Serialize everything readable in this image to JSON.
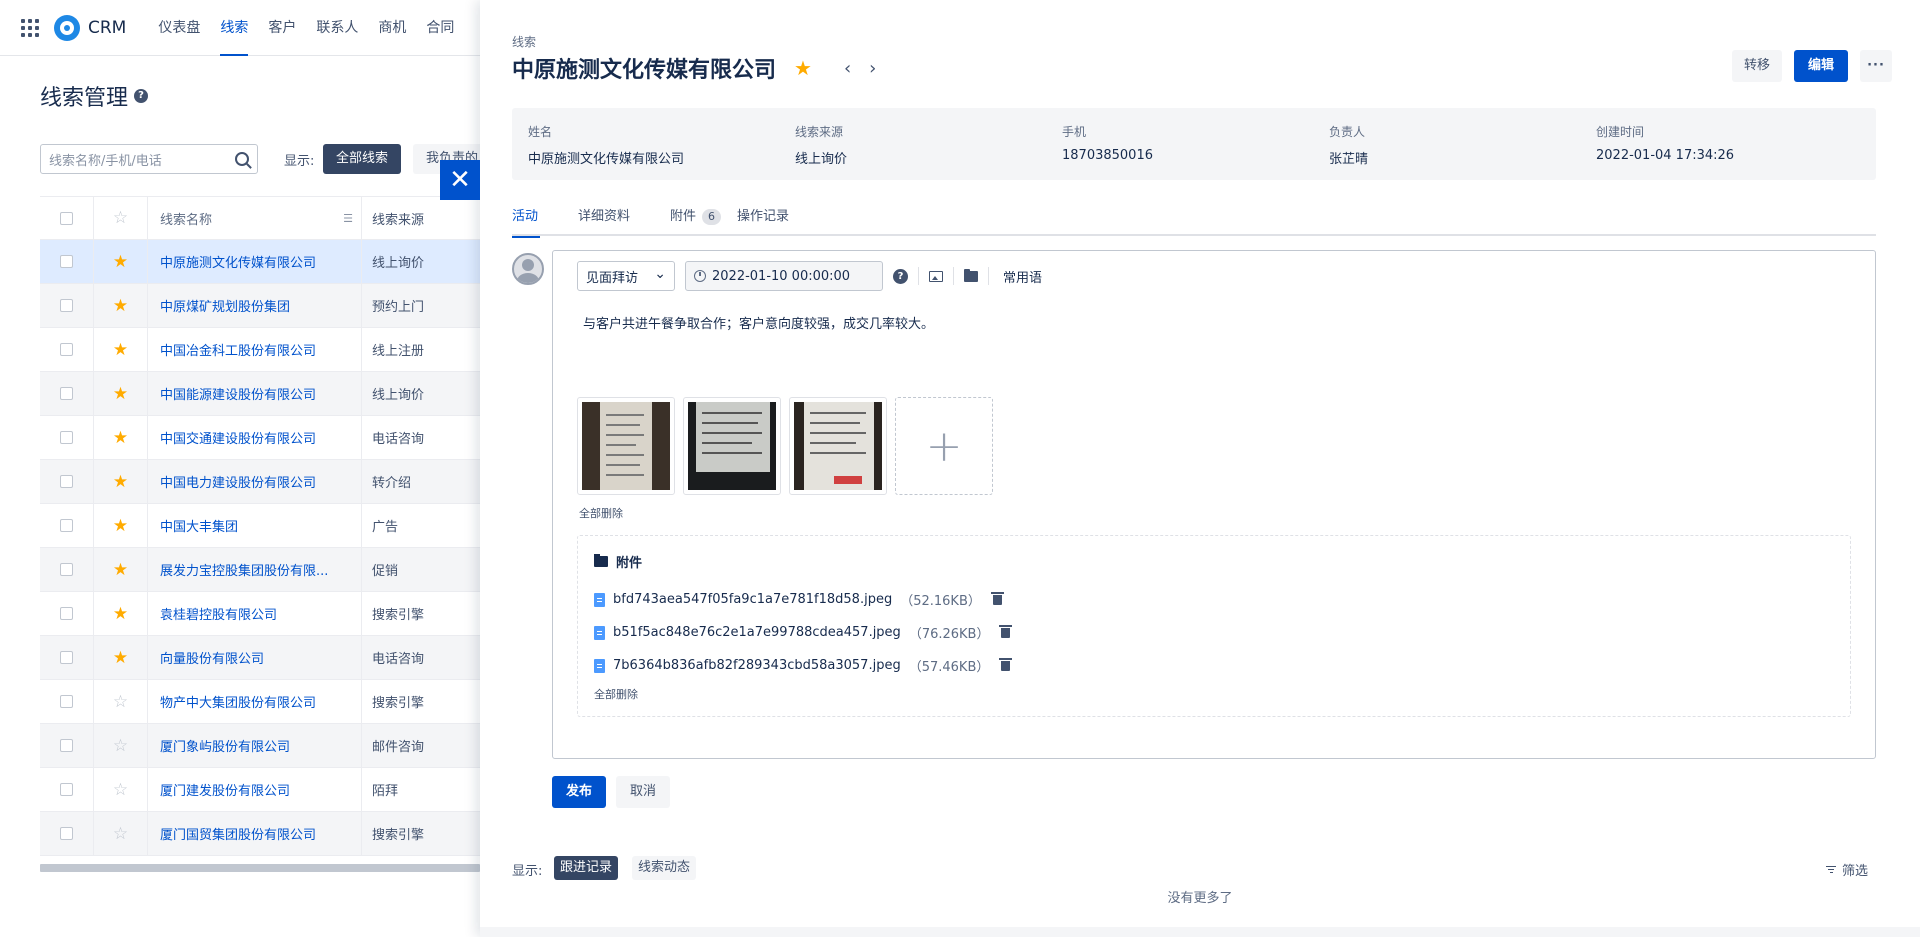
{
  "nav": {
    "brand": "CRM",
    "items": [
      "仪表盘",
      "线索",
      "客户",
      "联系人",
      "商机",
      "合同"
    ],
    "active_index": 1
  },
  "list_page": {
    "title": "线索管理",
    "help_icon": "?",
    "search_placeholder": "线索名称/手机/电话",
    "filter_label": "显示:",
    "filter_active": "全部线索",
    "filter_other": "我负责的",
    "columns": [
      "线索名称",
      "线索来源"
    ],
    "rows": [
      {
        "name": "中原施测文化传媒有限公司",
        "source": "线上询价",
        "starred": true,
        "selected": true
      },
      {
        "name": "中原煤矿规划股份集团",
        "source": "预约上门",
        "starred": true
      },
      {
        "name": "中国冶金科工股份有限公司",
        "source": "线上注册",
        "starred": true
      },
      {
        "name": "中国能源建设股份有限公司",
        "source": "线上询价",
        "starred": true
      },
      {
        "name": "中国交通建设股份有限公司",
        "source": "电话咨询",
        "starred": true
      },
      {
        "name": "中国电力建设股份有限公司",
        "source": "转介绍",
        "starred": true
      },
      {
        "name": "中国大丰集团",
        "source": "广告",
        "starred": true
      },
      {
        "name": "展发力宝控股集团股份有限...",
        "source": "促销",
        "starred": true
      },
      {
        "name": "袁桂碧控股有限公司",
        "source": "搜索引擎",
        "starred": true
      },
      {
        "name": "向量股份有限公司",
        "source": "电话咨询",
        "starred": true
      },
      {
        "name": "物产中大集团股份有限公司",
        "source": "搜索引擎",
        "starred": false
      },
      {
        "name": "厦门象屿股份有限公司",
        "source": "邮件咨询",
        "starred": false
      },
      {
        "name": "厦门建发股份有限公司",
        "source": "陌拜",
        "starred": false
      },
      {
        "name": "厦门国贸集团股份有限公司",
        "source": "搜索引擎",
        "starred": false
      }
    ],
    "close_glyph": "✕"
  },
  "detail": {
    "breadcrumb": "线索",
    "title": "中原施测文化传媒有限公司",
    "prev_glyph": "‹",
    "next_glyph": "›",
    "star_glyph": "★",
    "actions": {
      "transfer": "转移",
      "edit": "编辑",
      "more": "···"
    },
    "info": [
      {
        "label": "姓名",
        "value": "中原施测文化传媒有限公司"
      },
      {
        "label": "线索来源",
        "value": "线上询价"
      },
      {
        "label": "手机",
        "value": "18703850016"
      },
      {
        "label": "负责人",
        "value": "张芷晴"
      },
      {
        "label": "创建时间",
        "value": "2022-01-04 17:34:26"
      }
    ],
    "tabs": [
      {
        "label": "活动",
        "active": true
      },
      {
        "label": "详细资料"
      },
      {
        "label": "附件",
        "badge": "6"
      },
      {
        "label": "操作记录"
      }
    ],
    "editor": {
      "activity_type": "见面拜访",
      "chevron": "⌄",
      "datetime": "2022-01-10 00:00:00",
      "help": "?",
      "phrases": "常用语",
      "content": "与客户共进午餐争取合作；客户意向度较强，成交几率较大。",
      "add_glyph": "+",
      "delete_all_images": "全部删除",
      "attachments_title": "附件",
      "files": [
        {
          "name": "bfd743aea547f05fa9c1a7e781f18d58.jpeg",
          "size": "（52.16KB）"
        },
        {
          "name": "b51f5ac848e76c2e1a7e99788cdea457.jpeg",
          "size": "（76.26KB）"
        },
        {
          "name": "7b6364b836afb82f289343cbd58a3057.jpeg",
          "size": "（57.46KB）"
        }
      ],
      "delete_all_files": "全部删除",
      "publish": "发布",
      "cancel": "取消"
    },
    "feed": {
      "show_label": "显示:",
      "active": "跟进记录",
      "other": "线索动态",
      "filter": "筛选",
      "no_more": "没有更多了"
    }
  },
  "colors": {
    "primary": "#0052cc",
    "dark_pill": "#344563",
    "star": "#ffab00",
    "selected_row": "#deebff"
  }
}
